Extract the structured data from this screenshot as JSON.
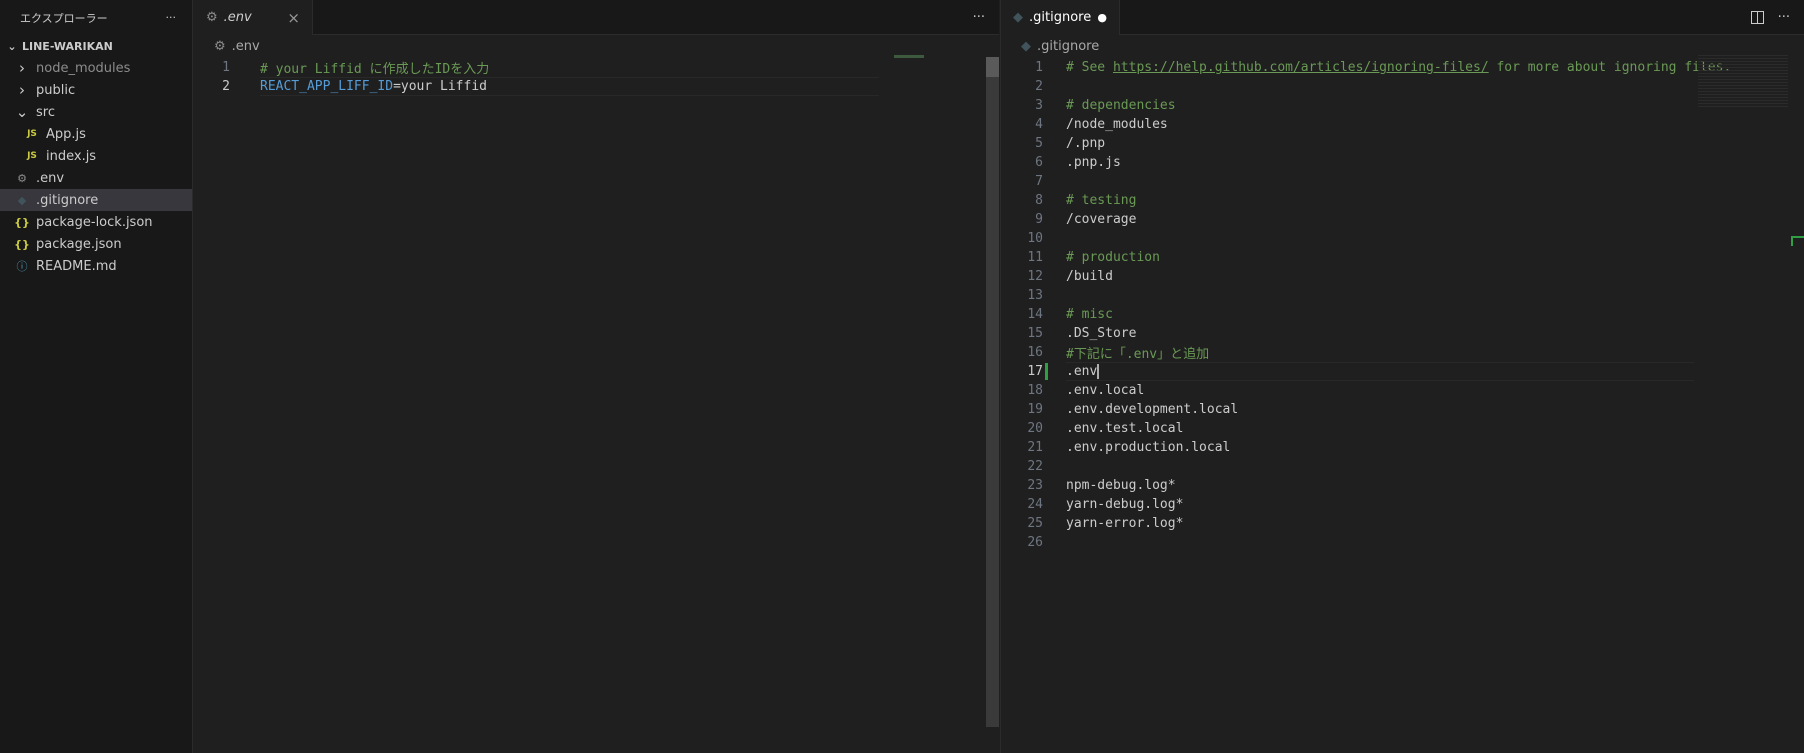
{
  "sidebar": {
    "title": "エクスプローラー",
    "more": "···",
    "root": "LINE-WARIKAN",
    "items": [
      {
        "label": "node_modules",
        "icon": "chevron-right",
        "indent": 1
      },
      {
        "label": "public",
        "icon": "chevron-right",
        "indent": 1
      },
      {
        "label": "src",
        "icon": "chevron-down",
        "indent": 1
      },
      {
        "label": "App.js",
        "icon": "js",
        "indent": 2
      },
      {
        "label": "index.js",
        "icon": "js",
        "indent": 2
      },
      {
        "label": ".env",
        "icon": "gear",
        "indent": 1
      },
      {
        "label": ".gitignore",
        "icon": "git",
        "indent": 1,
        "selected": true
      },
      {
        "label": "package-lock.json",
        "icon": "json",
        "indent": 1
      },
      {
        "label": "package.json",
        "icon": "json",
        "indent": 1
      },
      {
        "label": "README.md",
        "icon": "info",
        "indent": 1
      }
    ]
  },
  "left_editor": {
    "tab": ".env",
    "close": "×",
    "more": "···",
    "breadcrumb": ".env",
    "lines": [
      {
        "n": "1",
        "parts": [
          {
            "t": "# your Liffid に作成したIDを入力",
            "c": "cm"
          }
        ]
      },
      {
        "n": "2",
        "parts": [
          {
            "t": "REACT_APP_LIFF_ID",
            "c": "var"
          },
          {
            "t": "=your Liffid",
            "c": ""
          }
        ]
      }
    ]
  },
  "right_editor": {
    "tab": ".gitignore",
    "dirty": "●",
    "more": "···",
    "breadcrumb": ".gitignore",
    "lines": [
      {
        "n": "1",
        "parts": [
          {
            "t": "# See ",
            "c": "cm"
          },
          {
            "t": "https://help.github.com/articles/ignoring-files/",
            "c": "cm url"
          },
          {
            "t": " for more about ignoring files.",
            "c": "cm"
          }
        ]
      },
      {
        "n": "2",
        "parts": []
      },
      {
        "n": "3",
        "parts": [
          {
            "t": "# dependencies",
            "c": "cm"
          }
        ]
      },
      {
        "n": "4",
        "parts": [
          {
            "t": "/node_modules",
            "c": ""
          }
        ]
      },
      {
        "n": "5",
        "parts": [
          {
            "t": "/.pnp",
            "c": ""
          }
        ]
      },
      {
        "n": "6",
        "parts": [
          {
            "t": ".pnp.js",
            "c": ""
          }
        ]
      },
      {
        "n": "7",
        "parts": []
      },
      {
        "n": "8",
        "parts": [
          {
            "t": "# testing",
            "c": "cm"
          }
        ]
      },
      {
        "n": "9",
        "parts": [
          {
            "t": "/coverage",
            "c": ""
          }
        ]
      },
      {
        "n": "10",
        "parts": []
      },
      {
        "n": "11",
        "parts": [
          {
            "t": "# production",
            "c": "cm"
          }
        ]
      },
      {
        "n": "12",
        "parts": [
          {
            "t": "/build",
            "c": ""
          }
        ]
      },
      {
        "n": "13",
        "parts": []
      },
      {
        "n": "14",
        "parts": [
          {
            "t": "# misc",
            "c": "cm"
          }
        ]
      },
      {
        "n": "15",
        "parts": [
          {
            "t": ".DS_Store",
            "c": ""
          }
        ]
      },
      {
        "n": "16",
        "parts": [
          {
            "t": "#下記に「.env」と追加",
            "c": "cm"
          }
        ]
      },
      {
        "n": "17",
        "parts": [
          {
            "t": ".env",
            "c": ""
          }
        ],
        "current": true
      },
      {
        "n": "18",
        "parts": [
          {
            "t": ".env.local",
            "c": ""
          }
        ]
      },
      {
        "n": "19",
        "parts": [
          {
            "t": ".env.development.local",
            "c": ""
          }
        ]
      },
      {
        "n": "20",
        "parts": [
          {
            "t": ".env.test.local",
            "c": ""
          }
        ]
      },
      {
        "n": "21",
        "parts": [
          {
            "t": ".env.production.local",
            "c": ""
          }
        ]
      },
      {
        "n": "22",
        "parts": []
      },
      {
        "n": "23",
        "parts": [
          {
            "t": "npm-debug.log*",
            "c": ""
          }
        ]
      },
      {
        "n": "24",
        "parts": [
          {
            "t": "yarn-debug.log*",
            "c": ""
          }
        ]
      },
      {
        "n": "25",
        "parts": [
          {
            "t": "yarn-error.log*",
            "c": ""
          }
        ]
      },
      {
        "n": "26",
        "parts": []
      }
    ]
  }
}
